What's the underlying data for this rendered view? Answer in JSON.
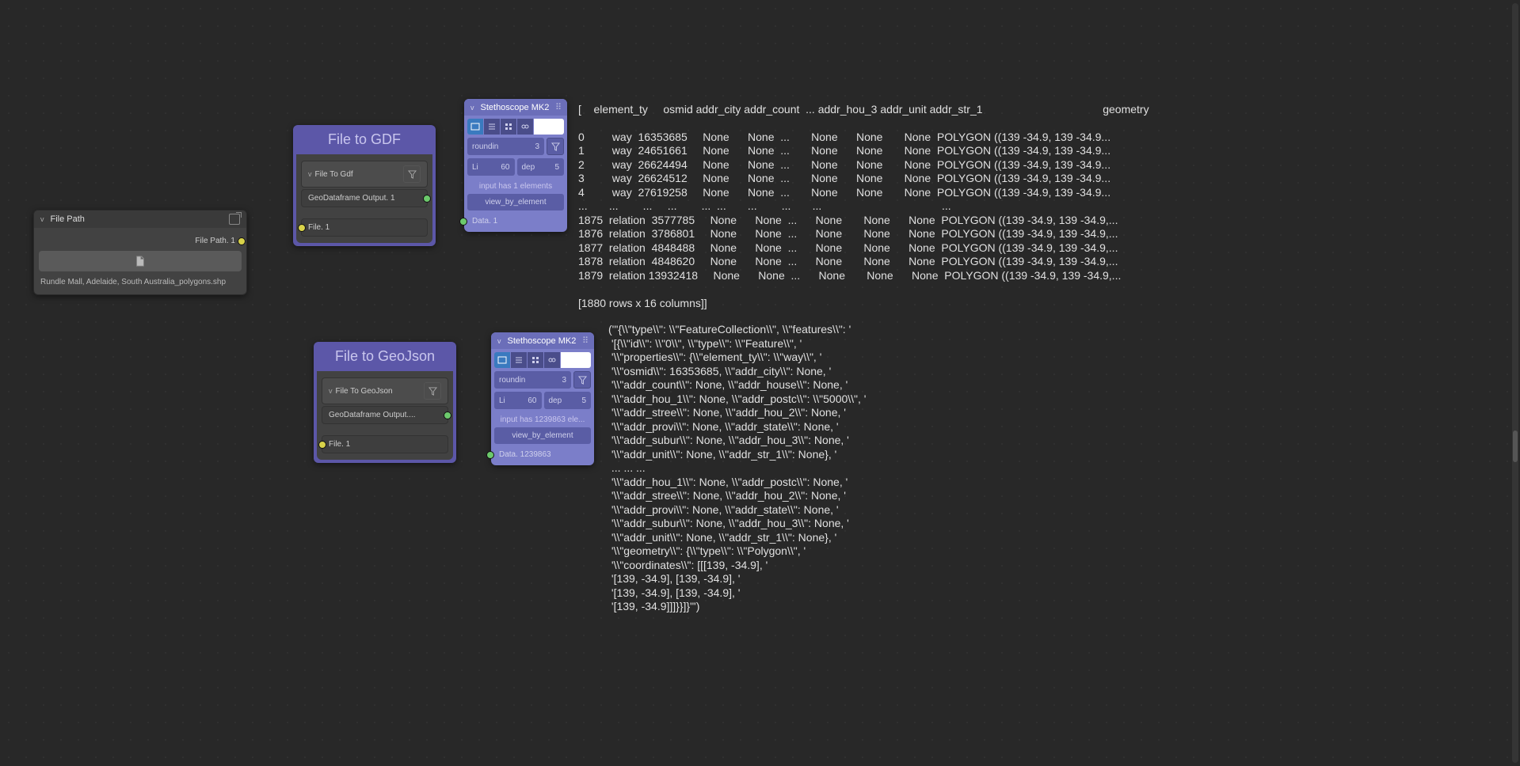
{
  "file_path_node": {
    "header": "File Path",
    "output_label": "File Path. 1",
    "file_label": "Rundle Mall, Adelaide, South Australia_polygons.shp"
  },
  "file_to_gdf": {
    "title": "File to GDF",
    "sub": "File To Gdf",
    "out_label": "GeoDataframe Output. 1",
    "in_label": "File. 1"
  },
  "file_to_geojson": {
    "title": "File to GeoJson",
    "sub": "File To GeoJson",
    "out_label": "GeoDataframe Output....",
    "in_label": "File. 1"
  },
  "steth1": {
    "header": "Stethoscope MK2",
    "roundin_label": "roundin",
    "roundin_val": "3",
    "li_label": "Li",
    "li_val": "60",
    "dep_label": "dep",
    "dep_val": "5",
    "info": "input has 1 elements",
    "btn": "view_by_element",
    "out": "Data. 1"
  },
  "steth2": {
    "header": "Stethoscope MK2",
    "roundin_label": "roundin",
    "roundin_val": "3",
    "li_label": "Li",
    "li_val": "60",
    "dep_label": "dep",
    "dep_val": "5",
    "info": "input has 1239863 ele...",
    "btn": "view_by_element",
    "out": "Data. 1239863"
  },
  "table": {
    "header": "[    element_ty     osmid addr_city addr_count  ... addr_hou_3 addr_unit addr_str_1                                       geometry",
    "rows": [
      "0         way  16353685     None      None  ...       None      None       None  POLYGON ((139 -34.9, 139 -34.9...",
      "1         way  24651661     None      None  ...       None      None       None  POLYGON ((139 -34.9, 139 -34.9...",
      "2         way  26624494     None      None  ...       None      None       None  POLYGON ((139 -34.9, 139 -34.9...",
      "3         way  26624512     None      None  ...       None      None       None  POLYGON ((139 -34.9, 139 -34.9...",
      "4         way  27619258     None      None  ...       None      None       None  POLYGON ((139 -34.9, 139 -34.9...",
      "...       ...        ...     ...        ...  ...       ...        ...       ...                                       ...",
      "1875  relation  3577785     None      None  ...      None       None      None  POLYGON ((139 -34.9, 139 -34.9,...",
      "1876  relation  3786801     None      None  ...      None       None      None  POLYGON ((139 -34.9, 139 -34.9,...",
      "1877  relation  4848488     None      None  ...      None       None      None  POLYGON ((139 -34.9, 139 -34.9,...",
      "1878  relation  4848620     None      None  ...      None       None      None  POLYGON ((139 -34.9, 139 -34.9,...",
      "1879  relation 13932418     None      None  ...      None       None      None  POLYGON ((139 -34.9, 139 -34.9,..."
    ],
    "footer": "[1880 rows x 16 columns]]"
  },
  "json_dump": "('\"{\\\\\"type\\\\\": \\\\\"FeatureCollection\\\\\", \\\\\"features\\\\\": '\n '[{\\\\\"id\\\\\": \\\\\"0\\\\\", \\\\\"type\\\\\": \\\\\"Feature\\\\\", '\n '\\\\\"properties\\\\\": {\\\\\"element_ty\\\\\": \\\\\"way\\\\\", '\n '\\\\\"osmid\\\\\": 16353685, \\\\\"addr_city\\\\\": None, '\n '\\\\\"addr_count\\\\\": None, \\\\\"addr_house\\\\\": None, '\n '\\\\\"addr_hou_1\\\\\": None, \\\\\"addr_postc\\\\\": \\\\\"5000\\\\\", '\n '\\\\\"addr_stree\\\\\": None, \\\\\"addr_hou_2\\\\\": None, '\n '\\\\\"addr_provi\\\\\": None, \\\\\"addr_state\\\\\": None, '\n '\\\\\"addr_subur\\\\\": None, \\\\\"addr_hou_3\\\\\": None, '\n '\\\\\"addr_unit\\\\\": None, \\\\\"addr_str_1\\\\\": None}, '\n ... ... ...\n '\\\\\"addr_hou_1\\\\\": None, \\\\\"addr_postc\\\\\": None, '\n '\\\\\"addr_stree\\\\\": None, \\\\\"addr_hou_2\\\\\": None, '\n '\\\\\"addr_provi\\\\\": None, \\\\\"addr_state\\\\\": None, '\n '\\\\\"addr_subur\\\\\": None, \\\\\"addr_hou_3\\\\\": None, '\n '\\\\\"addr_unit\\\\\": None, \\\\\"addr_str_1\\\\\": None}, '\n '\\\\\"geometry\\\\\": {\\\\\"type\\\\\": \\\\\"Polygon\\\\\", '\n '\\\\\"coordinates\\\\\": [[[139, -34.9], '\n '[139, -34.9], [139, -34.9], '\n '[139, -34.9], [139, -34.9], '\n '[139, -34.9]]]}}]}\"')"
}
